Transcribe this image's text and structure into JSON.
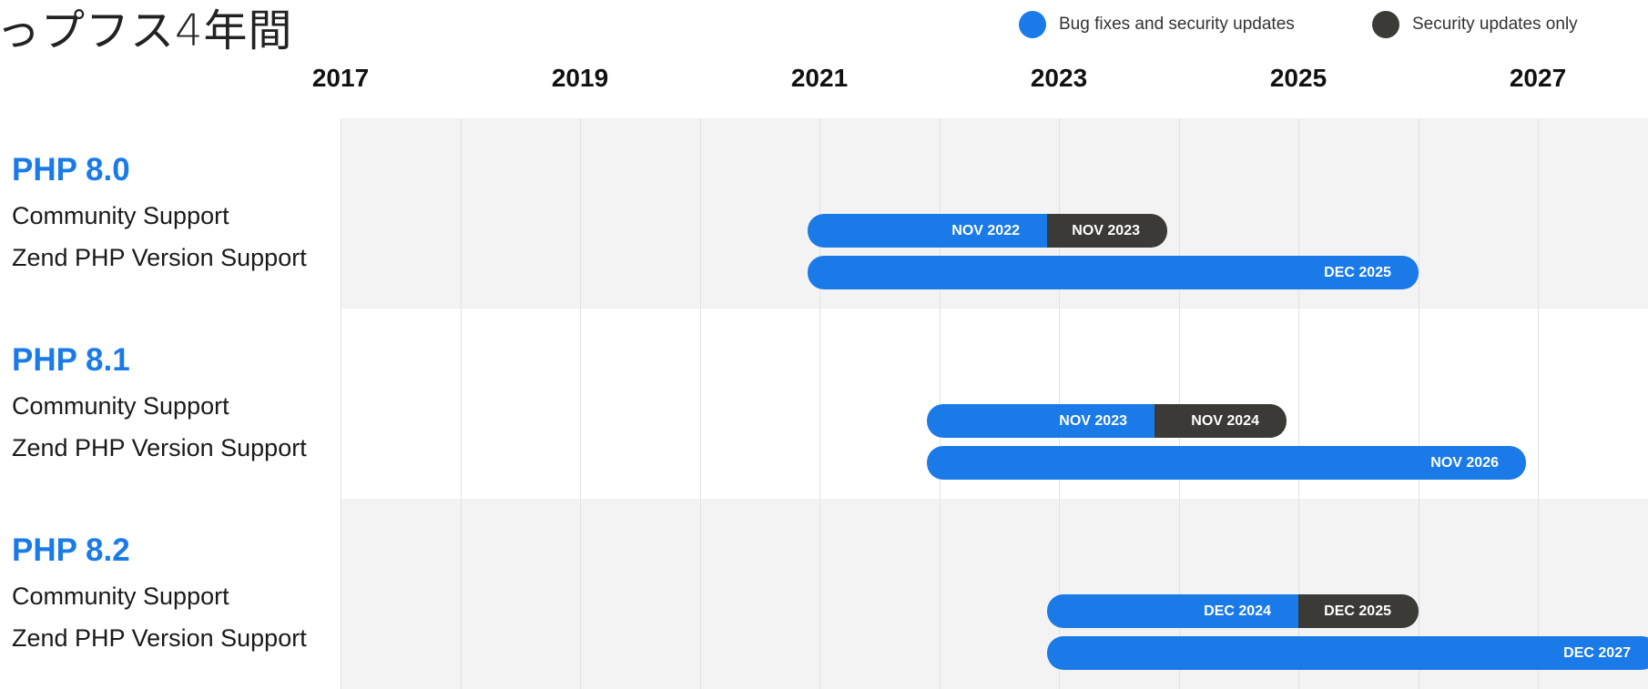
{
  "page": {
    "heading": "っプフス4年間"
  },
  "legend": [
    {
      "label": "Bug fixes and security updates",
      "color": "#1a7ae8",
      "icon": "blue-circle-icon"
    },
    {
      "label": "Security updates only",
      "color": "#3c3a37",
      "icon": "dark-circle-icon"
    }
  ],
  "chart_data": {
    "type": "gantt",
    "x_axis": {
      "unit": "year",
      "tick_labels": [
        "2017",
        "2019",
        "2021",
        "2023",
        "2025",
        "2027"
      ],
      "range": [
        2017,
        2028.0
      ]
    },
    "gridline_step_years": 1,
    "versions": [
      {
        "name": "PHP 8.0",
        "rows": [
          {
            "label": "Community Support",
            "start": 2020.9,
            "segments": [
              {
                "type": "Bug fixes and security updates",
                "end": 2022.9,
                "end_label": "NOV 2022"
              },
              {
                "type": "Security updates only",
                "end": 2023.9,
                "end_label": "NOV 2023"
              }
            ]
          },
          {
            "label": "Zend PHP Version Support",
            "start": 2020.9,
            "segments": [
              {
                "type": "Bug fixes and security updates",
                "end": 2026.0,
                "end_label": "DEC 2025"
              }
            ]
          }
        ]
      },
      {
        "name": "PHP 8.1",
        "rows": [
          {
            "label": "Community Support",
            "start": 2021.9,
            "segments": [
              {
                "type": "Bug fixes and security updates",
                "end": 2023.8,
                "end_label": "NOV 2023"
              },
              {
                "type": "Security updates only",
                "end": 2024.9,
                "end_label": "NOV 2024"
              }
            ]
          },
          {
            "label": "Zend PHP Version Support",
            "start": 2021.9,
            "segments": [
              {
                "type": "Bug fixes and security updates",
                "end": 2026.9,
                "end_label": "NOV 2026"
              }
            ]
          }
        ]
      },
      {
        "name": "PHP 8.2",
        "rows": [
          {
            "label": "Community Support",
            "start": 2022.9,
            "segments": [
              {
                "type": "Bug fixes and security updates",
                "end": 2025.0,
                "end_label": "DEC 2024"
              },
              {
                "type": "Security updates only",
                "end": 2026.0,
                "end_label": "DEC 2025"
              }
            ]
          },
          {
            "label": "Zend PHP Version Support",
            "start": 2022.9,
            "segments": [
              {
                "type": "Bug fixes and security updates",
                "end": 2028.0,
                "end_label": "DEC 2027"
              }
            ]
          }
        ]
      }
    ]
  }
}
